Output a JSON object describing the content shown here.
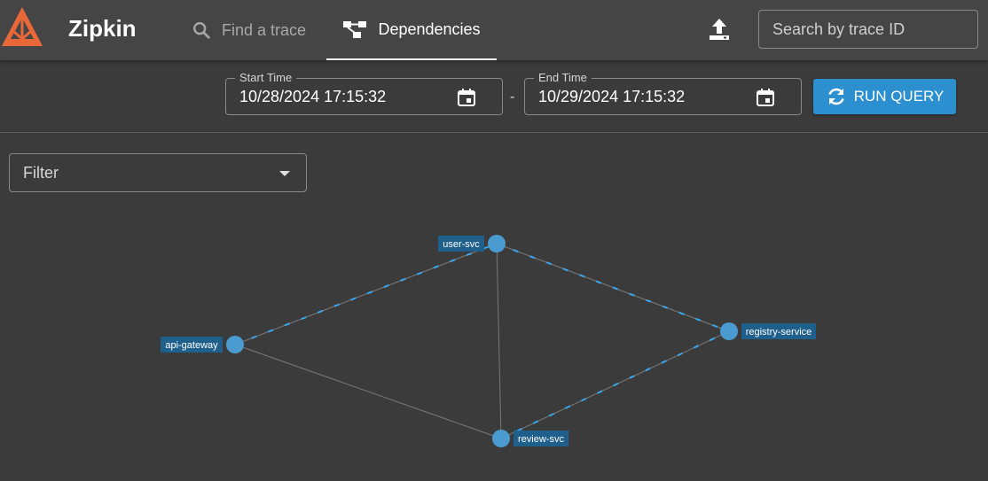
{
  "app": {
    "brand": "Zipkin"
  },
  "nav": {
    "find_trace": "Find a trace",
    "dependencies": "Dependencies"
  },
  "search": {
    "placeholder": "Search by trace ID"
  },
  "query": {
    "start_label": "Start Time",
    "start_value": "10/28/2024 17:15:32",
    "separator": "-",
    "end_label": "End Time",
    "end_value": "10/29/2024 17:15:32",
    "run_label": "RUN QUERY"
  },
  "filter": {
    "placeholder": "Filter"
  },
  "graph": {
    "nodes": [
      {
        "id": "user-svc",
        "label": "user-svc"
      },
      {
        "id": "api-gateway",
        "label": "api-gateway"
      },
      {
        "id": "registry-service",
        "label": "registry-service"
      },
      {
        "id": "review-svc",
        "label": "review-svc"
      }
    ],
    "edges": [
      {
        "from": "api-gateway",
        "to": "user-svc",
        "animated": true
      },
      {
        "from": "api-gateway",
        "to": "review-svc",
        "animated": false
      },
      {
        "from": "user-svc",
        "to": "review-svc",
        "animated": false
      },
      {
        "from": "user-svc",
        "to": "registry-service",
        "animated": true
      },
      {
        "from": "review-svc",
        "to": "registry-service",
        "animated": true
      }
    ]
  },
  "colors": {
    "accent": "#2b8fd0",
    "logo": "#e8683a",
    "node": "#4a9bd0",
    "edge_flow": "#3aa8f0"
  }
}
